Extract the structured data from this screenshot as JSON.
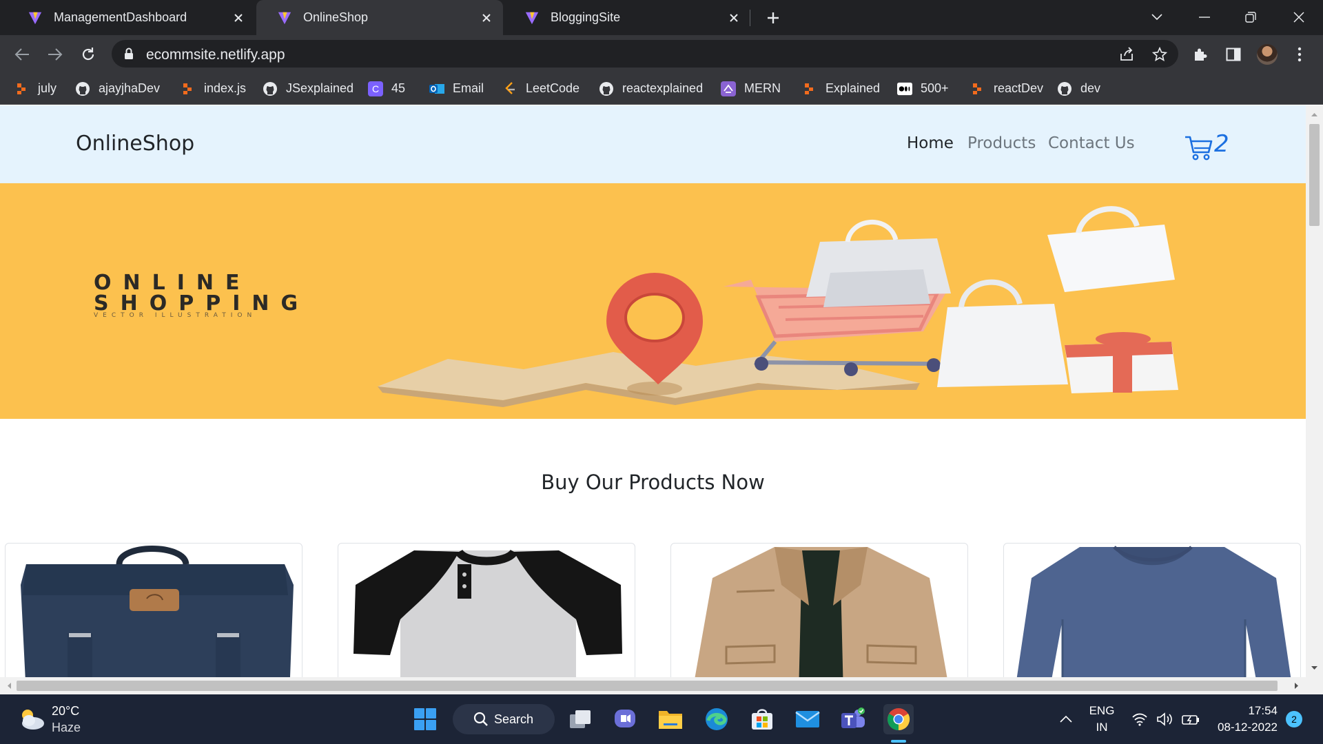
{
  "browser": {
    "tabs": [
      {
        "title": "ManagementDashboard",
        "active": false
      },
      {
        "title": "OnlineShop",
        "active": true
      },
      {
        "title": "BloggingSite",
        "active": false
      }
    ],
    "url": "ecommsite.netlify.app",
    "bookmarks": [
      {
        "label": "july",
        "icon": "dev-icon"
      },
      {
        "label": "ajayjhaDev",
        "icon": "github-icon"
      },
      {
        "label": "index.js",
        "icon": "dev-icon"
      },
      {
        "label": "JSexplained",
        "icon": "github-icon"
      },
      {
        "label": "45",
        "icon": "c-icon"
      },
      {
        "label": "Email",
        "icon": "outlook-icon"
      },
      {
        "label": "LeetCode",
        "icon": "leetcode-icon"
      },
      {
        "label": "reactexplained",
        "icon": "github-icon"
      },
      {
        "label": "MERN",
        "icon": "mern-icon"
      },
      {
        "label": "Explained",
        "icon": "dev-icon"
      },
      {
        "label": "500+",
        "icon": "medium-icon"
      },
      {
        "label": "reactDev",
        "icon": "dev-icon"
      },
      {
        "label": "dev",
        "icon": "github-icon"
      }
    ]
  },
  "site": {
    "brand": "OnlineShop",
    "nav": {
      "home": "Home",
      "products": "Products",
      "contact": "Contact Us"
    },
    "cart_count": "2",
    "hero": {
      "line1": "ONLINE",
      "line2": "SHOPPING",
      "line3": "VECTOR ILLUSTRATION"
    },
    "section_title": "Buy Our Products Now",
    "products": [
      {
        "image": "navy backpack"
      },
      {
        "image": "raglan henley t-shirt"
      },
      {
        "image": "khaki jacket"
      },
      {
        "image": "blue v-neck long sleeve"
      }
    ]
  },
  "taskbar": {
    "weather_temp": "20°C",
    "weather_desc": "Haze",
    "search_label": "Search",
    "lang_top": "ENG",
    "lang_bottom": "IN",
    "time": "17:54",
    "date": "08-12-2022",
    "notifications": "2"
  },
  "colors": {
    "nav_bg": "#e5f3fd",
    "hero_bg": "#fcc14e",
    "cart_accent": "#1b6fe0",
    "taskbar_bg": "#1c2436"
  }
}
